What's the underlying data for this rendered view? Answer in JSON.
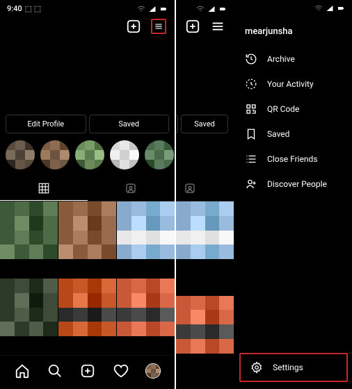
{
  "status": {
    "time": "9:40",
    "extra": "⬚ ⬚"
  },
  "left": {
    "buttons": {
      "edit": "Edit Profile",
      "saved": "Saved"
    }
  },
  "right": {
    "buttons": {
      "saved": "Saved"
    },
    "username": "mearjunsha",
    "menu": {
      "archive": "Archive",
      "activity": "Your Activity",
      "qr": "QR Code",
      "saved": "Saved",
      "close_friends": "Close Friends",
      "discover": "Discover People",
      "settings": "Settings"
    }
  },
  "highlight_palettes": [
    [
      "#5a4a3e",
      "#6b5d4f",
      "#3d332a",
      "#7a6b58",
      "#4e4237",
      "#8c7c68",
      "#2f2820",
      "#645547",
      "#564a3c"
    ],
    [
      "#7d5c42",
      "#8e6d52",
      "#5d4530",
      "#9d7a5d",
      "#6c5540",
      "#ae8b6e",
      "#4c3828",
      "#7d6249",
      "#6d5943"
    ],
    [
      "#6b8c5a",
      "#7a9d68",
      "#4c6d42",
      "#8aae78",
      "#5c7d4f",
      "#9abd87",
      "#3c5a33",
      "#6b8c5a",
      "#5b7a4a"
    ],
    [
      "#d8d8d8",
      "#e8e8e8",
      "#c8c8c8",
      "#f0f0f0",
      "#d0d0d0",
      "#f8f8f8",
      "#b8b8b8",
      "#e0e0e0",
      "#c0c0c0"
    ],
    [
      "#4a6b4a",
      "#5a7b5a",
      "#3a5b3a",
      "#6a8b6a",
      "#4a6b4a",
      "#7a9b7a",
      "#2a4b2a",
      "#5a7b5a",
      "#4a6b4a"
    ]
  ],
  "grid_palettes": [
    [
      "#3c5a38",
      "#4d6b47",
      "#2d4a2a",
      "#5e7c56",
      "#3c5a38",
      "#6f8d65",
      "#1e3a1c",
      "#4d6b47",
      "#3c5a38",
      "#5e7c56",
      "#2d4a2a",
      "#4d6b47",
      "#6f8d65",
      "#3c5a38",
      "#5e7c56",
      "#2d4a2a"
    ],
    [
      "#8a5a3c",
      "#9b6b4d",
      "#7a4a2d",
      "#ac7c5e",
      "#8a5a3c",
      "#bd8d6f",
      "#6a3a1e",
      "#9b6b4d",
      "#8a5a3c",
      "#ac7c5e",
      "#7a4a2d",
      "#9b6b4d",
      "#bd8d6f",
      "#8a5a3c",
      "#ac7c5e",
      "#7a4a2d"
    ],
    [
      "#88aacc",
      "#99bbdd",
      "#77aacc",
      "#aaccee",
      "#88aacc",
      "#bbddff",
      "#6699bb",
      "#99bbdd",
      "#e8e8e8",
      "#f0f0f0",
      "#e0e0e0",
      "#f8f8f8",
      "#88aacc",
      "#aaccee",
      "#77aacc",
      "#99bbdd"
    ],
    [
      "#2d3a28",
      "#3e4b38",
      "#1e2a1a",
      "#4f5c48",
      "#2d3a28",
      "#606d58",
      "#0f1b0c",
      "#3e4b38",
      "#2d3a28",
      "#4f5c48",
      "#1e2a1a",
      "#3e4b38",
      "#606d58",
      "#2d3a28",
      "#4f5c48",
      "#1e2a1a"
    ],
    [
      "#b84818",
      "#c95828",
      "#a83808",
      "#d96838",
      "#b84818",
      "#e97848",
      "#982800",
      "#c95828",
      "#2a2a2a",
      "#3a3a3a",
      "#1a1a1a",
      "#4a4a4a",
      "#b84818",
      "#d96838",
      "#a83808",
      "#c95828"
    ],
    [
      "#c85838",
      "#d96848",
      "#b84828",
      "#e97858",
      "#c85838",
      "#f98868",
      "#a83818",
      "#d96848",
      "#3a3a3a",
      "#4a4a4a",
      "#2a2a2a",
      "#5a5a5a",
      "#c85838",
      "#e97858",
      "#b84828",
      "#d96848"
    ]
  ]
}
